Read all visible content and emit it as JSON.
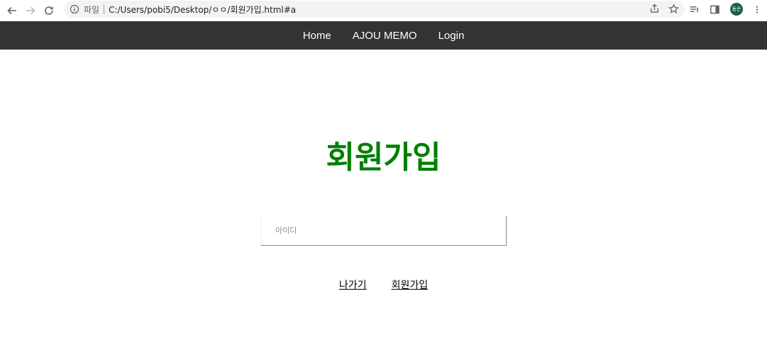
{
  "browser": {
    "file_label": "파일",
    "url": "C:/Users/pobi5/Desktop/ㅇㅇ/회원가입.html#a",
    "profile_initials": "동은"
  },
  "nav": {
    "items": [
      "Home",
      "AJOU MEMO",
      "Login"
    ]
  },
  "page": {
    "title": "회원가입",
    "id_placeholder": "아이디",
    "exit_label": "나가기",
    "signup_label": "회원가입",
    "title_color": "#008000",
    "nav_bg": "#333333"
  }
}
